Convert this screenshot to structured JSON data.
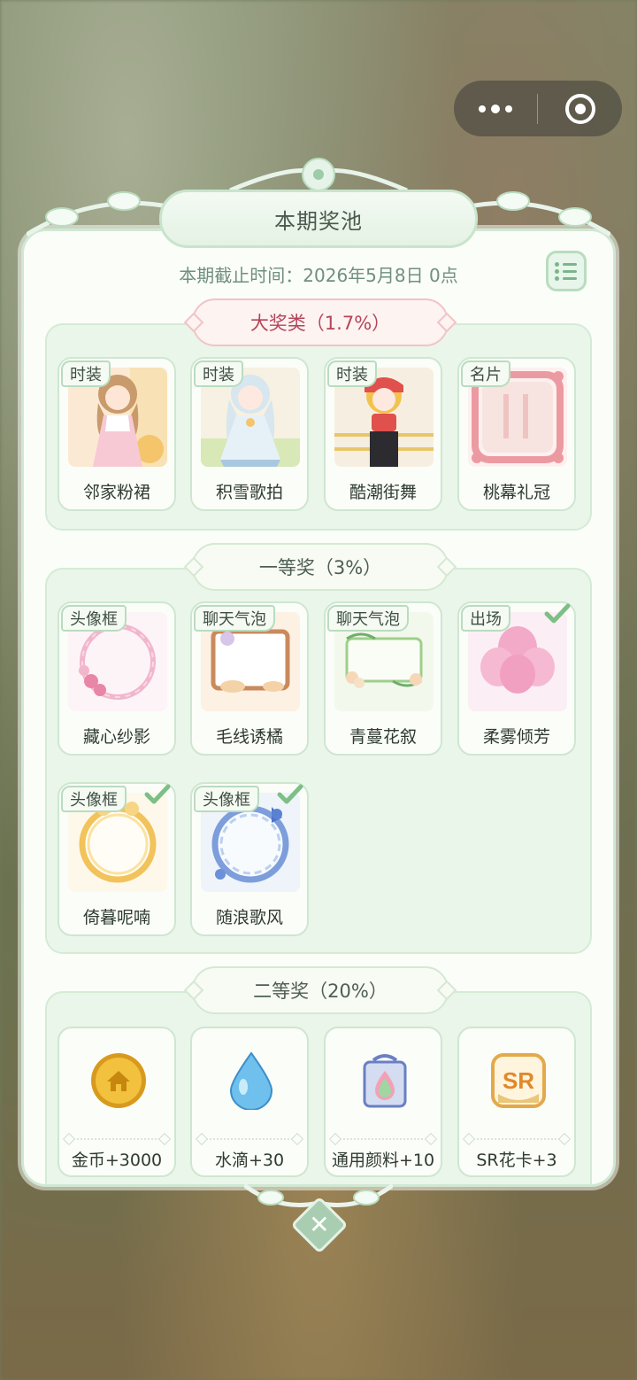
{
  "capsule": {
    "more_icon": "ellipsis-icon",
    "close_icon": "target-icon"
  },
  "header": {
    "title": "本期奖池",
    "deadline": "本期截止时间：2026年5月8日 0点",
    "list_icon": "list-icon"
  },
  "sections": [
    {
      "label": "大奖类（1.7%）",
      "items": [
        {
          "tag": "时装",
          "name": "邻家粉裙"
        },
        {
          "tag": "时装",
          "name": "积雪歌拍"
        },
        {
          "tag": "时装",
          "name": "酷潮街舞"
        },
        {
          "tag": "名片",
          "name": "桃幕礼冠"
        }
      ]
    },
    {
      "label": "一等奖（3%）",
      "items": [
        {
          "tag": "头像框",
          "name": "藏心纱影",
          "owned": false
        },
        {
          "tag": "聊天气泡",
          "name": "毛线诱橘",
          "owned": false
        },
        {
          "tag": "聊天气泡",
          "name": "青蔓花叙",
          "owned": false
        },
        {
          "tag": "出场",
          "name": "柔雾倾芳",
          "owned": true
        },
        {
          "tag": "头像框",
          "name": "倚暮呢喃",
          "owned": true
        },
        {
          "tag": "头像框",
          "name": "随浪歌风",
          "owned": true
        }
      ]
    },
    {
      "label": "二等奖（20%）",
      "items": [
        {
          "name": "金币+3000",
          "icon": "gold-coin-icon"
        },
        {
          "name": "水滴+30",
          "icon": "water-drop-icon"
        },
        {
          "name": "通用颜料+10",
          "icon": "paint-jar-icon"
        },
        {
          "name": "SR花卡+3",
          "icon": "sr-card-icon",
          "badge": "SR"
        }
      ]
    }
  ],
  "close_icon": "close-icon",
  "close_glyph": "✕"
}
